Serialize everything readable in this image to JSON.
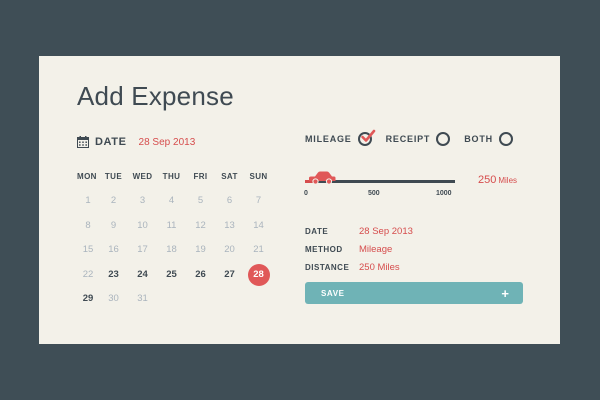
{
  "title": "Add Expense",
  "date_header": {
    "label": "DATE",
    "value": "28 Sep 2013"
  },
  "calendar": {
    "weekdays": [
      "MON",
      "TUE",
      "WED",
      "THU",
      "FRI",
      "SAT",
      "SUN"
    ],
    "weeks": [
      [
        {
          "d": "1",
          "s": "m"
        },
        {
          "d": "2",
          "s": "m"
        },
        {
          "d": "3",
          "s": "m"
        },
        {
          "d": "4",
          "s": "m"
        },
        {
          "d": "5",
          "s": "m"
        },
        {
          "d": "6",
          "s": "m"
        },
        {
          "d": "7",
          "s": "m"
        }
      ],
      [
        {
          "d": "8",
          "s": "m"
        },
        {
          "d": "9",
          "s": "m"
        },
        {
          "d": "10",
          "s": "m"
        },
        {
          "d": "11",
          "s": "m"
        },
        {
          "d": "12",
          "s": "m"
        },
        {
          "d": "13",
          "s": "m"
        },
        {
          "d": "14",
          "s": "m"
        }
      ],
      [
        {
          "d": "15",
          "s": "m"
        },
        {
          "d": "16",
          "s": "m"
        },
        {
          "d": "17",
          "s": "m"
        },
        {
          "d": "18",
          "s": "m"
        },
        {
          "d": "19",
          "s": "m"
        },
        {
          "d": "20",
          "s": "m"
        },
        {
          "d": "21",
          "s": "m"
        }
      ],
      [
        {
          "d": "22",
          "s": "m"
        },
        {
          "d": "23",
          "s": "a"
        },
        {
          "d": "24",
          "s": "a"
        },
        {
          "d": "25",
          "s": "a"
        },
        {
          "d": "26",
          "s": "a"
        },
        {
          "d": "27",
          "s": "a"
        },
        {
          "d": "28",
          "s": "sel"
        }
      ],
      [
        {
          "d": "29",
          "s": "a"
        },
        {
          "d": "30",
          "s": "m"
        },
        {
          "d": "31",
          "s": "m"
        }
      ]
    ]
  },
  "options": [
    {
      "label": "MILEAGE",
      "checked": true
    },
    {
      "label": "RECEIPT",
      "checked": false
    },
    {
      "label": "BOTH",
      "checked": false
    }
  ],
  "slider": {
    "min": 0,
    "max": 1000,
    "value": 83,
    "ticks": [
      "0",
      "500",
      "1000"
    ],
    "readout_value": "250",
    "readout_unit": "Miles"
  },
  "details": [
    {
      "key": "DATE",
      "value": "28 Sep 2013"
    },
    {
      "key": "METHOD",
      "value": "Mileage"
    },
    {
      "key": "DISTANCE",
      "value": "250 Miles"
    }
  ],
  "save": {
    "label": "SAVE",
    "icon": "plus-icon"
  },
  "colors": {
    "background": "#3f4e56",
    "card": "#f3f1e9",
    "text_dark": "#3f4a52",
    "accent_red": "#e05858",
    "teal": "#6fb3b6",
    "muted": "#aab4bd"
  }
}
